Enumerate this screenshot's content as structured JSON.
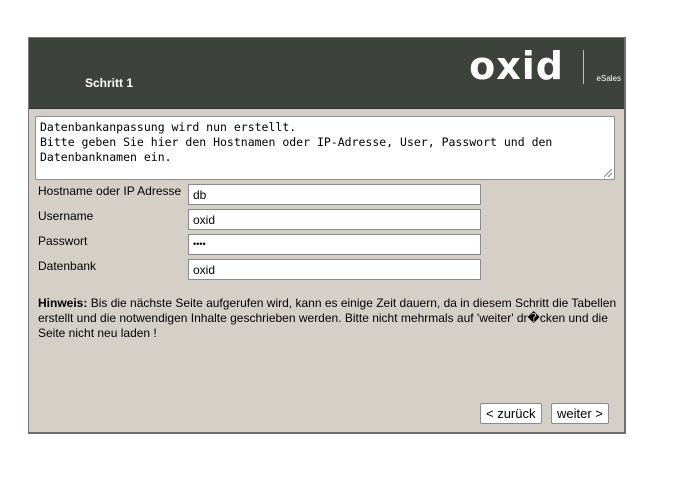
{
  "header": {
    "step": "Schritt 1",
    "logo": "oxid",
    "logo_sub": "eSales",
    "background": "#3d423d"
  },
  "info_text": "Datenbankanpassung wird nun erstellt.\nBitte geben Sie hier den Hostnamen oder IP-Adresse, User, Passwort und den Datenbanknamen ein.",
  "form": {
    "host": {
      "label": "Hostname oder IP Adresse",
      "value": "db"
    },
    "user": {
      "label": "Username",
      "value": "oxid"
    },
    "password": {
      "label": "Passwort",
      "value": "••••"
    },
    "database": {
      "label": "Datenbank",
      "value": "oxid"
    }
  },
  "hint": {
    "title": "Hinweis:",
    "text": "Bis die nächste Seite aufgerufen wird, kann es einige Zeit dauern, da in diesem Schritt die Tabellen erstellt und die notwendigen Inhalte geschrieben werden. Bitte nicht mehrmals auf 'weiter' dr�cken und die Seite nicht neu laden !"
  },
  "buttons": {
    "back": "< zurück",
    "next": "weiter >"
  },
  "colors": {
    "panel": "#d4d0c8"
  }
}
